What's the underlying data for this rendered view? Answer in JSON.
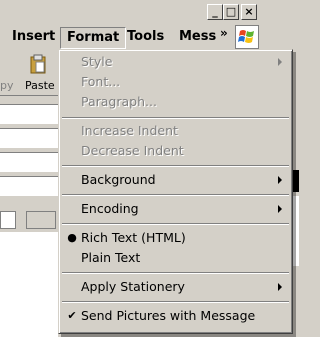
{
  "titlebar": {
    "minimize": "_",
    "maximize": "□",
    "close": "×"
  },
  "menubar": {
    "items": [
      {
        "label": "Insert"
      },
      {
        "label": "Format"
      },
      {
        "label": "Tools"
      },
      {
        "label": "Mess"
      }
    ],
    "overflow": "»"
  },
  "toolbar": {
    "partial_label": "py",
    "paste_label": "Paste"
  },
  "format_menu": {
    "items": [
      {
        "label": "Style",
        "disabled": true,
        "submenu": true
      },
      {
        "label": "Font...",
        "disabled": true
      },
      {
        "label": "Paragraph...",
        "disabled": true
      },
      {
        "label": "Increase Indent",
        "disabled": true
      },
      {
        "label": "Decrease Indent",
        "disabled": true
      },
      {
        "label": "Background",
        "submenu": true
      },
      {
        "label": "Encoding",
        "submenu": true
      },
      {
        "label": "Rich Text (HTML)",
        "radio_selected": true
      },
      {
        "label": "Plain Text"
      },
      {
        "label": "Apply Stationery",
        "submenu": true
      },
      {
        "label": "Send Pictures with Message",
        "checked": true
      }
    ]
  },
  "colors": {
    "face": "#d4d0c8",
    "disabled_text": "#808080"
  }
}
